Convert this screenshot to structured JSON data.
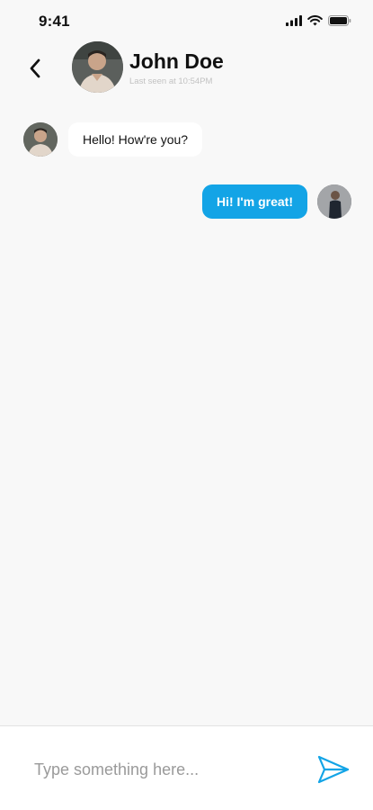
{
  "status_bar": {
    "time": "9:41",
    "icons": [
      "signal-icon",
      "wifi-icon",
      "battery-icon"
    ]
  },
  "header": {
    "back_icon": "chevron-left-icon",
    "contact_name": "John Doe",
    "last_seen": "Last seen at 10:54PM"
  },
  "messages": [
    {
      "direction": "incoming",
      "text": "Hello! How're you?"
    },
    {
      "direction": "outgoing",
      "text": "Hi! I'm great!"
    }
  ],
  "composer": {
    "placeholder": "Type something here...",
    "value": "",
    "send_icon": "send-icon"
  },
  "colors": {
    "accent": "#13a4e6",
    "background": "#f8f8f8",
    "incoming_bubble": "#ffffff",
    "outgoing_text": "#ffffff",
    "muted_text": "#c2c2c2"
  }
}
